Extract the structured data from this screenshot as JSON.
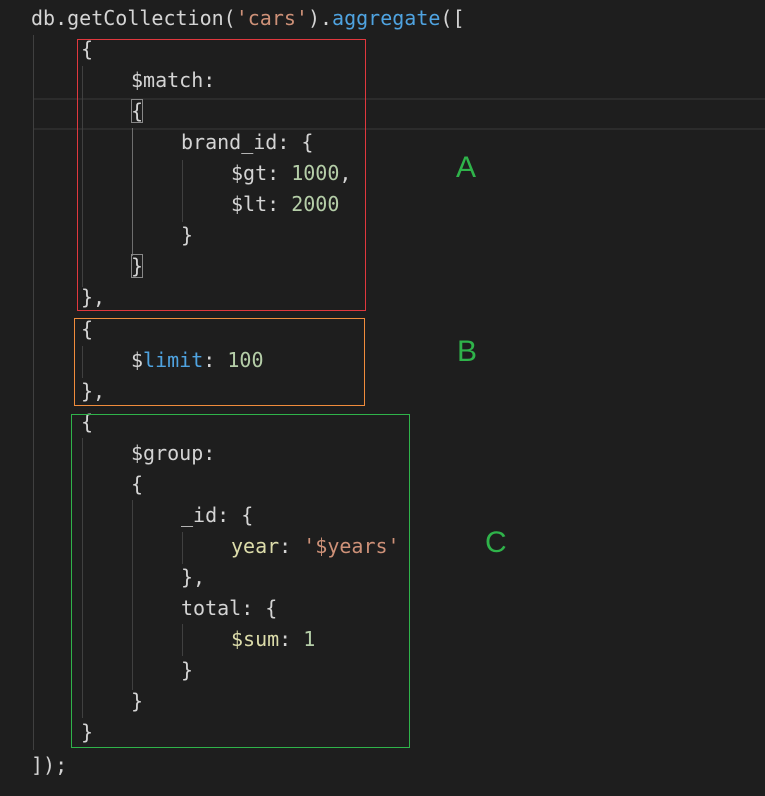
{
  "code": {
    "l1": {
      "pre": "db.getCollection(",
      "str": "'cars'",
      "mid": ").",
      "fn": "aggregate",
      "post": "(["
    },
    "l2": "{",
    "l3": "$match:",
    "l4": "{",
    "l5": "brand_id: {",
    "l6": {
      "key": "$gt: ",
      "num": "1000",
      "post": ","
    },
    "l7": {
      "key": "$lt: ",
      "num": "2000"
    },
    "l8": "}",
    "l9": "}",
    "l10": "},",
    "l11": "{",
    "l12": {
      "pre": "$",
      "key": "limit",
      "sep": ": ",
      "num": "100"
    },
    "l13": "},",
    "l14": "{",
    "l15": "$group:",
    "l16": "{",
    "l17": "_id: {",
    "l18": {
      "key": "year",
      "sep": ": ",
      "str": "'$years'"
    },
    "l19": "},",
    "l20": "total: {",
    "l21": {
      "key": "$sum",
      "sep": ": ",
      "num": "1"
    },
    "l22": "}",
    "l23": "}",
    "l24": "}",
    "l25": "]);"
  },
  "annotations": [
    {
      "label": "A",
      "color": "#e0383e"
    },
    {
      "label": "B",
      "color": "#f08c3c"
    },
    {
      "label": "C",
      "color": "#2fb34a"
    }
  ],
  "colors": {
    "label_text": "#2fb34a",
    "background": "#1e1e1e"
  }
}
